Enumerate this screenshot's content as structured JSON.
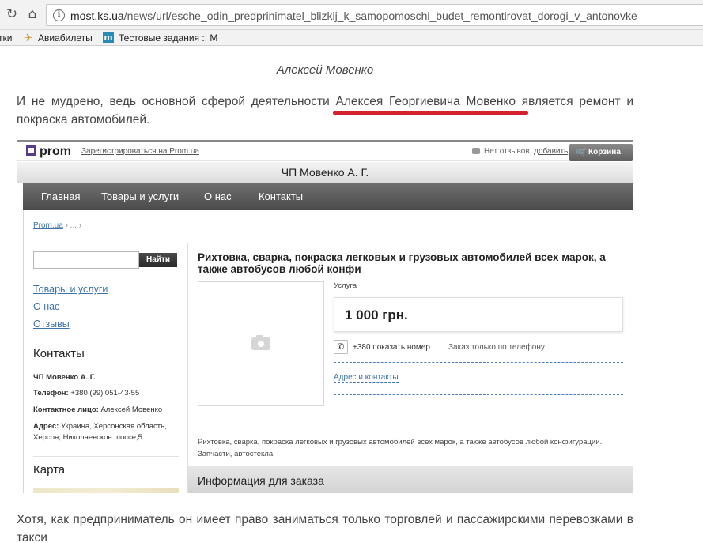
{
  "browser": {
    "url_host": "most.ks.ua",
    "url_path": "/news/url/esche_odin_predprinimatel_blizkij_k_samopomoschi_budet_remontirovat_dorogi_v_antonovke",
    "bookmarks": [
      "тки",
      "Авиабилеты",
      "Тестовые задания :: М"
    ]
  },
  "article": {
    "author": "Алексей Мовенко",
    "paragraph1": "И не мудрено, ведь основной сферой деятельности Алексея Георгиевича Мовенко является ремонт и покраска автомобилей.",
    "paragraph2": "Хотя, как предприниматель он имеет право заниматься только торговлей и пассажирскими перевозками в такси"
  },
  "prom": {
    "logo": "prom",
    "register_link": "Зарегистрироваться на Prom.ua",
    "reviews_text": "Нет отзывов,",
    "reviews_add": "добавить",
    "cart": "Корзина",
    "shop_title": "ЧП Мовенко А. Г.",
    "menu": [
      "Главная",
      "Товары и услуги",
      "О нас",
      "Контакты"
    ],
    "breadcrumb_link": "Prom.ua",
    "breadcrumb_rest": "› ... ›",
    "search_button": "Найти",
    "search_placeholder": "",
    "side_links": [
      "Товары и услуги",
      "О нас",
      "Отзывы"
    ],
    "contacts_heading": "Контакты",
    "contacts": {
      "company": "ЧП Мовенко А. Г.",
      "phone_label": "Телефон:",
      "phone": "+380 (99) 051-43-55",
      "person_label": "Контактное лицо:",
      "person": "Алексей Мовенко",
      "address_label": "Адрес:",
      "address": "Украина, Херсонская область, Херсон, Николаевское шоссе,5"
    },
    "map_heading": "Карта",
    "product": {
      "title": "Рихтовка, сварка, покраска легковых и грузовых автомобилей всех марок, а также автобусов любой конфи",
      "service_label": "Услуга",
      "price": "1 000 грн.",
      "phone_show": "+380 показать номер",
      "phone_note": "Заказ только по телефону",
      "address_link": "Адрес и контакты",
      "description": "Рихтовка, сварка, покраска легковых и грузовых автомобилей всех марок, а также автобусов любой конфигурации. Запчасти, автостекла.",
      "order_info": "Информация для заказа"
    }
  }
}
